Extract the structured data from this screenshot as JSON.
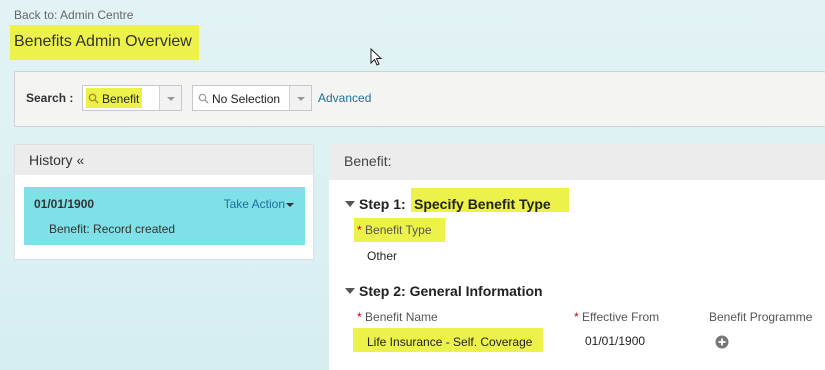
{
  "header": {
    "back_link": "Back to: Admin Centre",
    "page_title": "Benefits Admin Overview"
  },
  "search": {
    "label": "Search :",
    "primary_value": "Benefit",
    "secondary_value": "No Selection",
    "advanced_link": "Advanced"
  },
  "history": {
    "title": "History «",
    "items": [
      {
        "date": "01/01/1900",
        "action_label": "Take Action",
        "description": "Benefit: Record created"
      }
    ]
  },
  "main": {
    "title": "Benefit:",
    "step1": {
      "prefix": "Step 1:",
      "title": "Specify Benefit Type",
      "field_label": "Benefit Type",
      "field_value": "Other"
    },
    "step2": {
      "title": "Step 2: General Information",
      "columns": {
        "name_label": "Benefit Name",
        "effective_label": "Effective From",
        "programme_label": "Benefit Programme"
      },
      "row": {
        "name": "Life Insurance - Self. Coverage",
        "effective_from": "01/01/1900"
      }
    }
  },
  "colors": {
    "highlight": "#ecf24a",
    "history_card": "#7ee1e8",
    "link": "#1f6e9a",
    "required": "#d10000"
  },
  "icons": {
    "search": "magnifier-icon",
    "dropdown": "chevron-down-icon",
    "expand": "caret-down-icon",
    "add": "plus-circle-icon"
  }
}
